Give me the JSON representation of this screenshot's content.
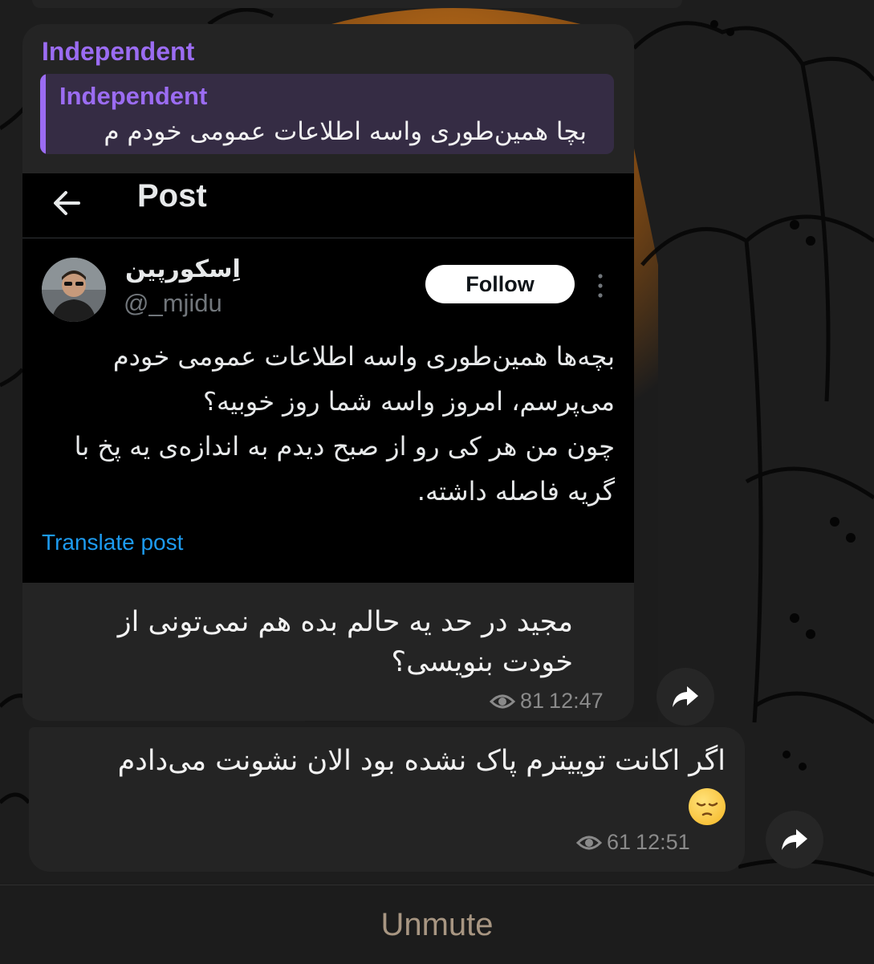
{
  "theme": {
    "accent": "#9b6cf2",
    "bubble": "#242424",
    "link": "#1d9bf0",
    "unmute_color": "#a89682"
  },
  "message1": {
    "sender": "Independent",
    "reply": {
      "name": "Independent",
      "text": "بچا همین‌طوری واسه اطلاعات عمومی خودم م"
    },
    "screenshot": {
      "header_title": "Post",
      "display_name": "اِسکورپین",
      "handle": "@_mjidu",
      "follow_label": "Follow",
      "tweet_lines": [
        "بچه‌ها همین‌طوری واسه اطلاعات عمومی خودم",
        "می‌پرسم، امروز واسه شما روز خوبیه؟",
        "چون من هر کی رو از صبح دیدم به اندازه‌ی یه پخ با",
        "گریه فاصله داشته."
      ],
      "translate_label": "Translate post"
    },
    "caption_lines": [
      "مجید در حد یه حالم بده هم نمی‌تونی از",
      "خودت بنویسی؟"
    ],
    "views": "81",
    "time": "12:47"
  },
  "message2": {
    "text_lines": [
      "اگر اکانت توییترم پاک نشده بود الان نشونت می‌دادم"
    ],
    "emoji": "pensive-face",
    "views": "61",
    "time": "12:51"
  },
  "bottom_bar": {
    "unmute_label": "Unmute"
  },
  "icons": [
    "back-arrow-icon",
    "more-vertical-icon",
    "eye-icon",
    "forward-icon"
  ]
}
